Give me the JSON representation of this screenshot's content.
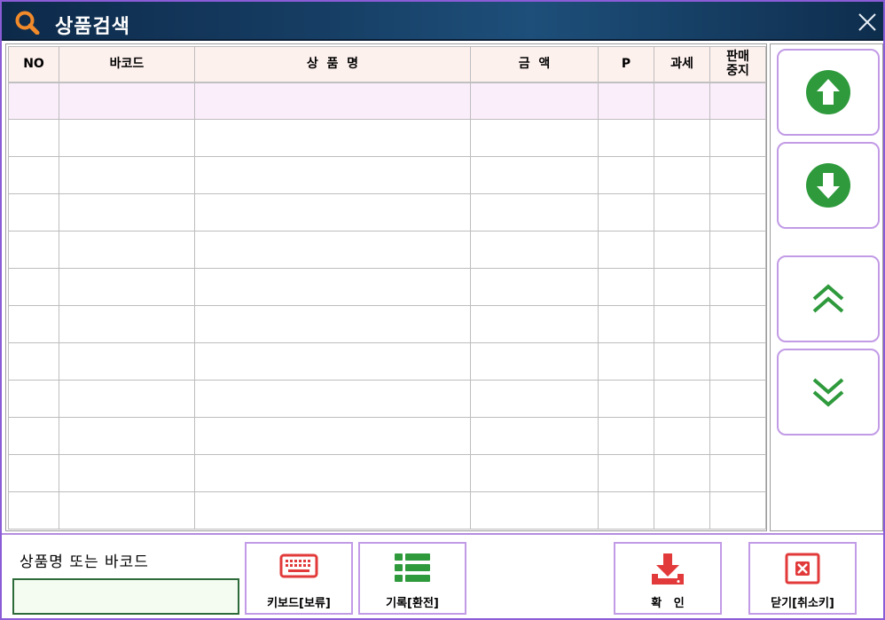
{
  "window": {
    "title": "상품검색",
    "accent_color": "#8a5cd6"
  },
  "table": {
    "columns": [
      "NO",
      "바코드",
      "상  품  명",
      "금  액",
      "P",
      "과세",
      "판매\n중지"
    ],
    "selected_row_color": "#fbeefb",
    "header_color": "#fdf1ee",
    "row_count": 12
  },
  "nav": {
    "up_icon": "circle-arrow-up-icon",
    "down_icon": "circle-arrow-down-icon",
    "page_up_icon": "double-chevron-up-icon",
    "page_down_icon": "double-chevron-down-icon",
    "icon_color": "#2e9a3c"
  },
  "search": {
    "label": "상품명 또는 바코드",
    "value": ""
  },
  "actions": {
    "keyboard_label": "키보드[보류]",
    "history_label": "기록[환전]",
    "confirm_label": "확   인",
    "close_label": "닫기[취소키]"
  }
}
